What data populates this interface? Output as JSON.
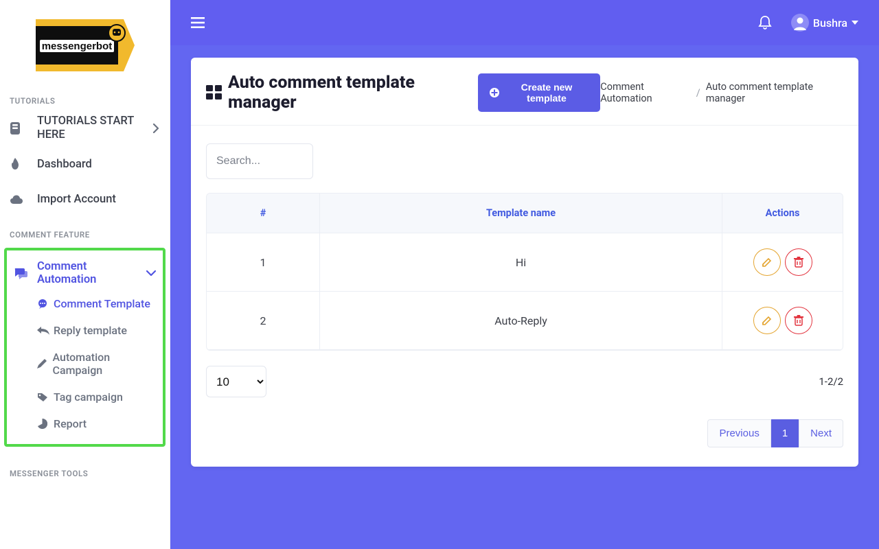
{
  "logo": {
    "text": "messengerbot"
  },
  "sidebar": {
    "sections": {
      "tutorials_title": "TUTORIALS",
      "tutorials_start": "TUTORIALS START HERE",
      "dashboard": "Dashboard",
      "import_account": "Import Account",
      "comment_feature_title": "COMMENT FEATURE",
      "comment_automation": "Comment Automation",
      "sub": {
        "comment_template": "Comment Template",
        "reply_template": "Reply template",
        "automation_campaign": "Automation Campaign",
        "tag_campaign": "Tag campaign",
        "report": "Report"
      },
      "messenger_tools_title": "MESSENGER TOOLS"
    }
  },
  "topbar": {
    "user_name": "Bushra"
  },
  "page": {
    "title": "Auto comment template manager",
    "create_btn": "Create new template",
    "breadcrumb": {
      "a": "Comment Automation",
      "b": "Auto comment template manager"
    },
    "search_placeholder": "Search..."
  },
  "table": {
    "headers": {
      "num": "#",
      "name": "Template name",
      "actions": "Actions"
    },
    "rows": [
      {
        "num": "1",
        "name": "Hi"
      },
      {
        "num": "2",
        "name": "Auto-Reply"
      }
    ],
    "page_size": "10",
    "counter": "1-2/2",
    "pagination": {
      "prev": "Previous",
      "page": "1",
      "next": "Next"
    }
  }
}
